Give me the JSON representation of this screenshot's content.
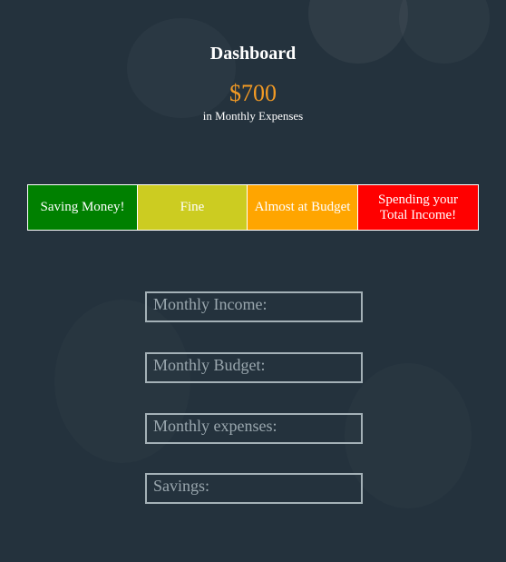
{
  "header": {
    "title": "Dashboard",
    "expense_amount": "$700",
    "expense_caption": "in Monthly Expenses"
  },
  "status_bar": {
    "segments": [
      {
        "label": "Saving Money!",
        "color": "#008000"
      },
      {
        "label": "Fine",
        "color": "#cccc21"
      },
      {
        "label": "Almost at Budget",
        "color": "#ffa500"
      },
      {
        "label": "Spending your Total Income!",
        "color": "#ff0000"
      }
    ]
  },
  "form": {
    "fields": [
      {
        "label": "Monthly Income:"
      },
      {
        "label": "Monthly Budget:"
      },
      {
        "label": "Monthly expenses:"
      },
      {
        "label": "Savings:"
      }
    ]
  },
  "colors": {
    "background": "#24323d",
    "accent": "#f29a24",
    "field_border": "#a4b1b7"
  }
}
